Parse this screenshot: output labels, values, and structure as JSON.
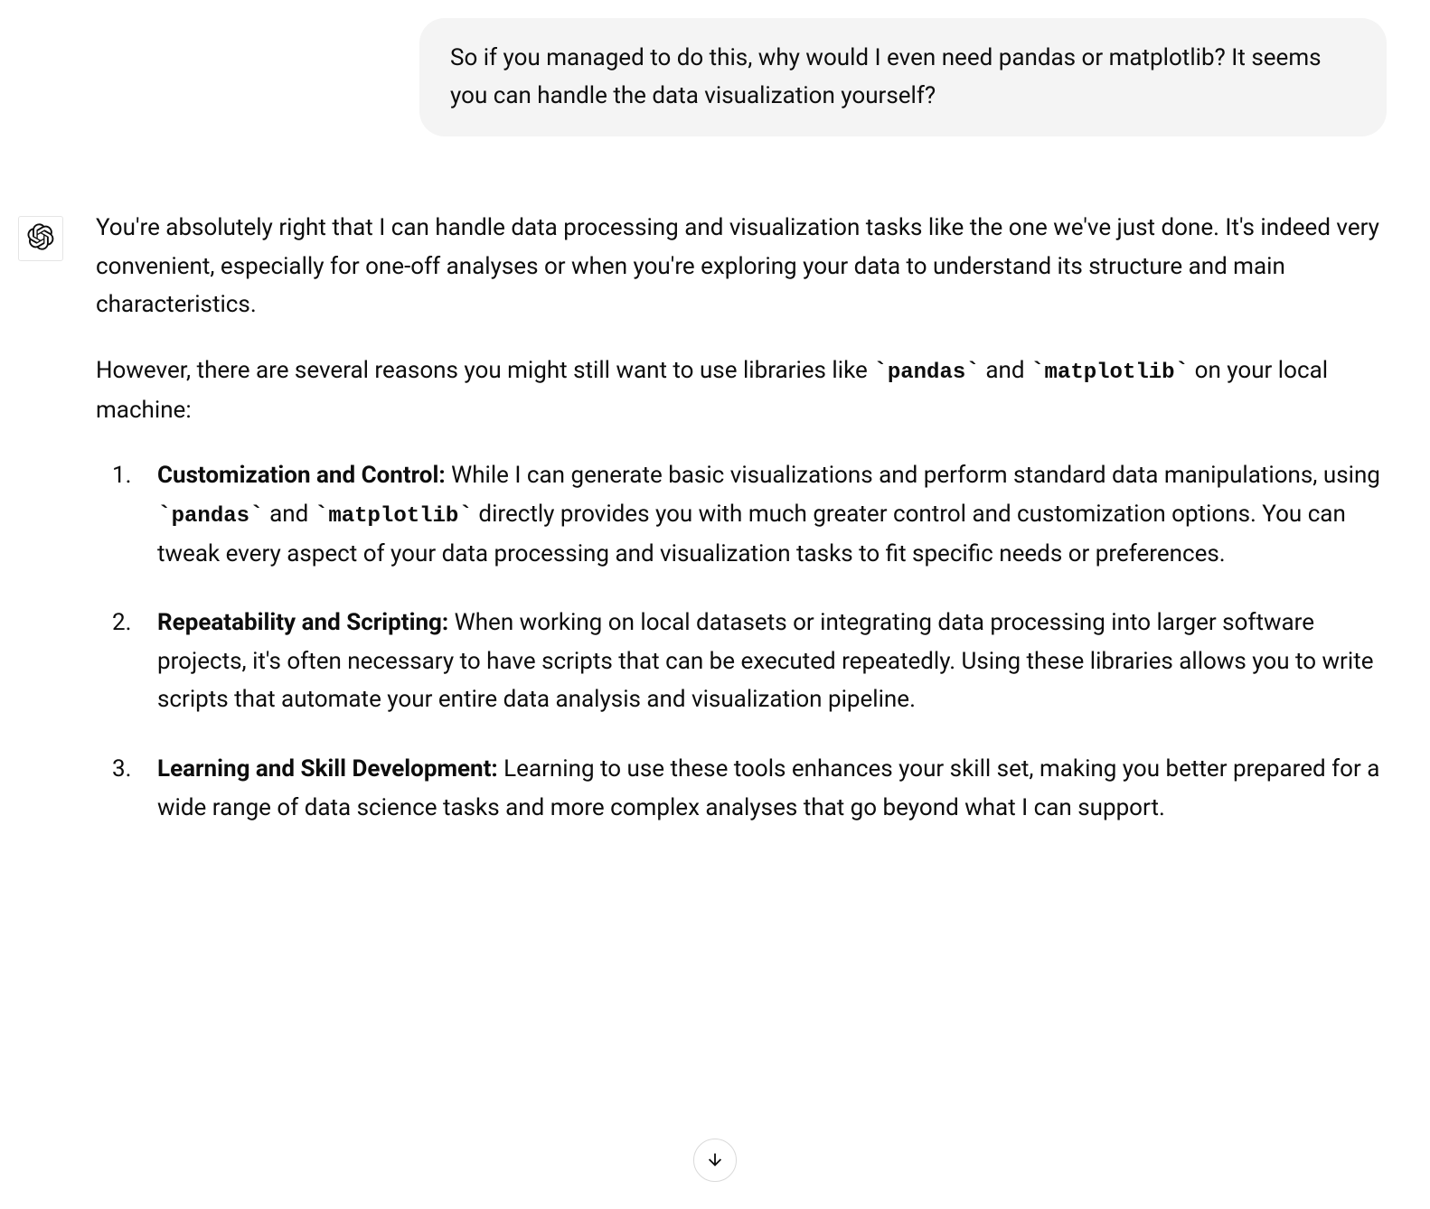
{
  "user_message": "So if you managed to do this, why would I even need pandas or matplotlib? It seems you can handle the data visualization yourself?",
  "assistant": {
    "intro_p1": "You're absolutely right that I can handle data processing and visualization tasks like the one we've just done. It's indeed very convenient, especially for one-off analyses or when you're exploring your data to understand its structure and main characteristics.",
    "intro_p2_prefix": "However, there are several reasons you might still want to use libraries like ",
    "code_pandas": "pandas",
    "intro_p2_middle": " and ",
    "code_matplotlib": "matplotlib",
    "intro_p2_suffix": " on your local machine:",
    "list": [
      {
        "title": "Customization and Control:",
        "body_prefix": " While I can generate basic visualizations and perform standard data manipulations, using ",
        "code1": "pandas",
        "body_mid": " and ",
        "code2": "matplotlib",
        "body_suffix": " directly provides you with much greater control and customization options. You can tweak every aspect of your data processing and visualization tasks to fit specific needs or preferences."
      },
      {
        "title": "Repeatability and Scripting:",
        "body": " When working on local datasets or integrating data processing into larger software projects, it's often necessary to have scripts that can be executed repeatedly. Using these libraries allows you to write scripts that automate your entire data analysis and visualization pipeline."
      },
      {
        "title": "Learning and Skill Development:",
        "body": " Learning to use these tools enhances your skill set, making you better prepared for a wide range of data science tasks and more complex analyses that go beyond what I can support."
      }
    ]
  }
}
